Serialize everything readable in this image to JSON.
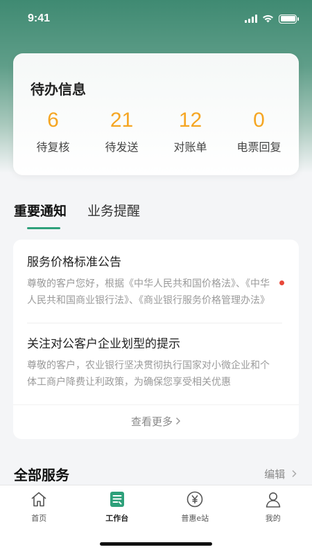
{
  "status_bar": {
    "time": "9:41"
  },
  "todo": {
    "title": "待办信息",
    "stats": [
      {
        "count": "6",
        "label": "待复核"
      },
      {
        "count": "21",
        "label": "待发送"
      },
      {
        "count": "12",
        "label": "对账单"
      },
      {
        "count": "0",
        "label": "电票回复"
      }
    ]
  },
  "notice_tabs": [
    "重要通知",
    "业务提醒"
  ],
  "notices": [
    {
      "title": "服务价格标准公告",
      "text": "尊敬的客户您好，根据《中华人民共和国价格法》、《中华人民共和国商业银行法》、《商业银行服务价格管理办法》",
      "unread": true
    },
    {
      "title": "关注对公客户企业划型的提示",
      "text": "尊敬的客户，农业银行坚决贯彻执行国家对小微企业和个体工商户降费让利政策，为确保您享受相关优惠",
      "unread": false
    }
  ],
  "more_label": "查看更多",
  "services": {
    "title": "全部服务",
    "edit_label": "编辑"
  },
  "tabbar": [
    {
      "label": "首页",
      "icon": "home-icon"
    },
    {
      "label": "工作台",
      "icon": "workbench-icon"
    },
    {
      "label": "普惠e站",
      "icon": "yuan-icon"
    },
    {
      "label": "我的",
      "icon": "user-icon"
    }
  ],
  "colors": {
    "accent": "#2ea07a",
    "count": "#f5a623",
    "unread": "#e8483a",
    "header": "#3f8a72"
  }
}
